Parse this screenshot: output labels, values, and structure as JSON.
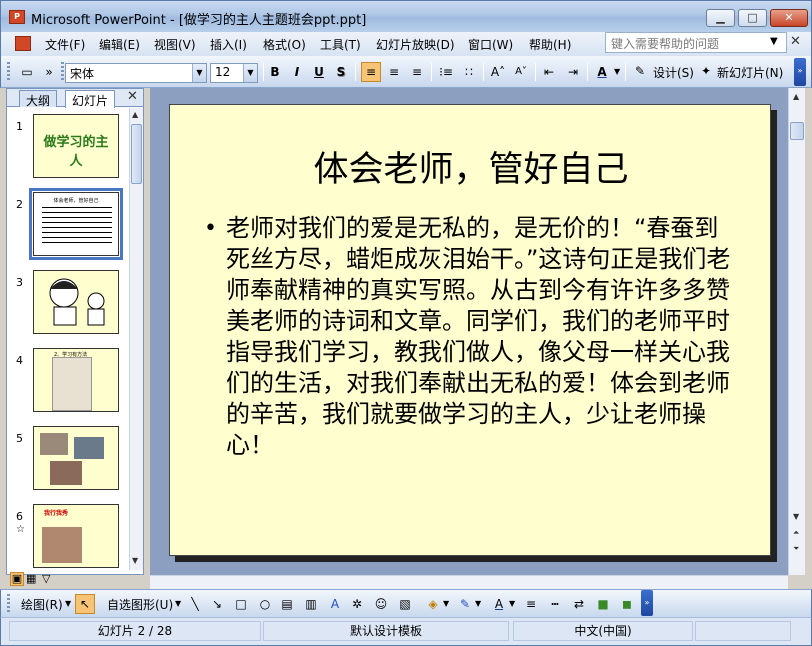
{
  "window": {
    "title": "Microsoft PowerPoint - [做学习的主人主题班会ppt.ppt]",
    "app_icon_letter": "P"
  },
  "menubar": {
    "items": [
      "文件(F)",
      "编辑(E)",
      "视图(V)",
      "插入(I)",
      "格式(O)",
      "工具(T)",
      "幻灯片放映(D)",
      "窗口(W)",
      "帮助(H)"
    ],
    "help_placeholder": "键入需要帮助的问题"
  },
  "toolbar": {
    "font_name": "宋体",
    "font_size": "12",
    "bold": "B",
    "italic": "I",
    "underline": "U",
    "shadow": "S",
    "design_label": "设计(S)",
    "new_slide_label": "新幻灯片(N)"
  },
  "outline_pane": {
    "tabs": [
      "大纲",
      "幻灯片"
    ],
    "active_tab": "幻灯片",
    "slides": [
      {
        "number": "1",
        "thumb_text": "做学习的主人"
      },
      {
        "number": "2",
        "thumb_text": "体会老师，管好自己",
        "selected": true
      },
      {
        "number": "3",
        "thumb_text": ""
      },
      {
        "number": "4",
        "thumb_text": "2、学习有方法"
      },
      {
        "number": "5",
        "thumb_text": ""
      },
      {
        "number": "6",
        "thumb_text": "我行我秀"
      }
    ]
  },
  "slide": {
    "title": "体会老师，管好自己",
    "bullet": "•",
    "body": "老师对我们的爱是无私的，是无价的！“春蚕到死丝方尽，蜡炬成灰泪始干。”这诗句正是我们老师奉献精神的真实写照。从古到今有许许多多赞美老师的诗词和文章。同学们，我们的老师平时指导我们学习，教我们做人，像父母一样关心我们的生活，对我们奉献出无私的爱！体会到老师的辛苦，我们就要做学习的主人，少让老师操心！",
    "background_color": "#fffece"
  },
  "drawbar": {
    "draw_label": "绘图(R)",
    "autoshape_label": "自选图形(U)"
  },
  "statusbar": {
    "slide_position": "幻灯片 2 / 28",
    "template": "默认设计模板",
    "language": "中文(中国)"
  }
}
